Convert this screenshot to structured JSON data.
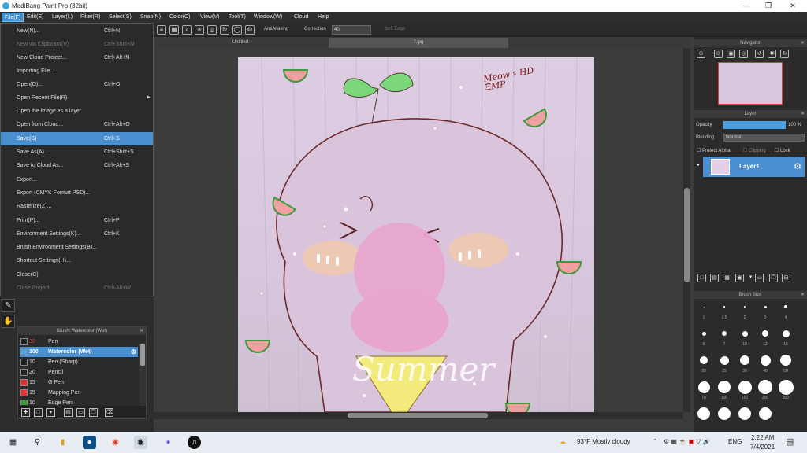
{
  "window": {
    "title": "MediBang Paint Pro (32bit)"
  },
  "menu": [
    "File(F)",
    "Edit(E)",
    "Layer(L)",
    "Filter(R)",
    "Select(S)",
    "Snap(N)",
    "Color(C)",
    "View(V)",
    "Tool(T)",
    "Window(W)",
    "Cloud",
    "Help"
  ],
  "file_menu": [
    {
      "label": "New(N)...",
      "shortcut": "Ctrl+N",
      "disabled": false
    },
    {
      "label": "New via Clipboard(V)",
      "shortcut": "Ctrl+Shift+N",
      "disabled": true
    },
    {
      "label": "New Cloud Project...",
      "shortcut": "Ctrl+Alt+N",
      "disabled": false
    },
    {
      "label": "Importing File...",
      "shortcut": "",
      "disabled": false
    },
    {
      "label": "Open(O)...",
      "shortcut": "Ctrl+O",
      "disabled": false
    },
    {
      "label": "Open Recent File(R)",
      "shortcut": "",
      "disabled": false,
      "submenu": true
    },
    {
      "label": "Open the image as a layer.",
      "shortcut": "",
      "disabled": false
    },
    {
      "label": "Open from Cloud...",
      "shortcut": "Ctrl+Alt+O",
      "disabled": false
    },
    {
      "label": "Save(S)",
      "shortcut": "Ctrl+S",
      "disabled": false,
      "selected": true
    },
    {
      "label": "Save As(A)...",
      "shortcut": "Ctrl+Shift+S",
      "disabled": false
    },
    {
      "label": "Save to Cloud As...",
      "shortcut": "Ctrl+Alt+S",
      "disabled": false
    },
    {
      "label": "Export...",
      "shortcut": "",
      "disabled": false
    },
    {
      "label": "Export (CMYK Format PSD)...",
      "shortcut": "",
      "disabled": false
    },
    {
      "label": "Rasterize(Z)...",
      "shortcut": "",
      "disabled": false
    },
    {
      "label": "Print(P)...",
      "shortcut": "Ctrl+P",
      "disabled": false
    },
    {
      "label": "Environment Settings(K)...",
      "shortcut": "Ctrl+K",
      "disabled": false
    },
    {
      "label": "Brush Environment Settings(B)...",
      "shortcut": "",
      "disabled": false
    },
    {
      "label": "Shortcut Settings(H)...",
      "shortcut": "",
      "disabled": false
    },
    {
      "label": "Close(C)",
      "shortcut": "",
      "disabled": false
    },
    {
      "label": "Close Project",
      "shortcut": "Ctrl+Alt+W",
      "disabled": true
    }
  ],
  "toolbar": {
    "antialias": "AntiAliasing",
    "correction_label": "Correction",
    "correction_value": "40",
    "soft_edge": "Soft Edge"
  },
  "tabs": [
    "Untitled",
    "7.jpg"
  ],
  "artwork": {
    "note_text": "Meow ♯ HD ΞMΡ",
    "script_text": "Summer"
  },
  "brush_panel": {
    "title": "Brush: Watercolor (Wet)",
    "items": [
      {
        "size": "30",
        "name": "Pen",
        "color": "#222222"
      },
      {
        "size": "100",
        "name": "Watercolor (Wet)",
        "color": "#4aa8e8",
        "selected": true
      },
      {
        "size": "10",
        "name": "Pen (Sharp)",
        "color": "#222222"
      },
      {
        "size": "20",
        "name": "Pencil",
        "color": "#222222"
      },
      {
        "size": "15",
        "name": "G Pen",
        "color": "#e03030"
      },
      {
        "size": "15",
        "name": "Mapping Pen",
        "color": "#e03030"
      },
      {
        "size": "10",
        "name": "Edge Pen",
        "color": "#30a030"
      }
    ]
  },
  "navigator": {
    "title": "Navigator"
  },
  "layer_panel": {
    "title": "Layer",
    "opacity_label": "Opacity",
    "opacity_value": "100 %",
    "blending_label": "Blending",
    "blending_value": "Normal",
    "protect_alpha": "Protect Alpha",
    "clipping": "Clipping",
    "lock": "Lock",
    "layer_name": "Layer1"
  },
  "brush_size": {
    "title": "Brush Size",
    "labels": [
      "1",
      "1.5",
      "2",
      "3",
      "4",
      "5",
      "7",
      "10",
      "12",
      "15",
      "20",
      "25",
      "30",
      "40",
      "50",
      "70",
      "100",
      "150",
      "200",
      "300"
    ]
  },
  "taskbar": {
    "weather": "93°F Mostly cloudy",
    "lang": "ENG",
    "time": "2:22 AM",
    "date": "7/4/2021"
  }
}
